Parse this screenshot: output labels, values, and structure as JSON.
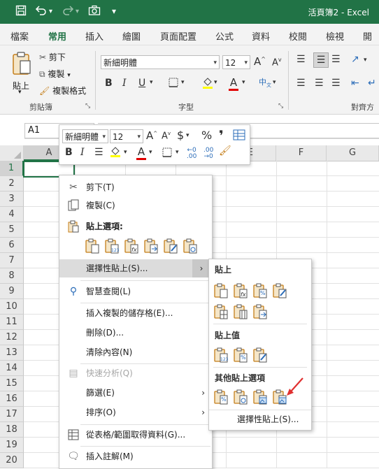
{
  "window": {
    "title": "活頁簿2 - Excel"
  },
  "qat": {
    "save_icon": "save-icon",
    "undo_icon": "undo-icon",
    "redo_icon": "redo-icon",
    "camera_icon": "camera-icon",
    "customize_icon": "customize-qat-icon"
  },
  "tabs": [
    {
      "label": "檔案"
    },
    {
      "label": "常用"
    },
    {
      "label": "插入"
    },
    {
      "label": "繪圖"
    },
    {
      "label": "頁面配置"
    },
    {
      "label": "公式"
    },
    {
      "label": "資料"
    },
    {
      "label": "校閱"
    },
    {
      "label": "檢視"
    },
    {
      "label": "開發"
    }
  ],
  "ribbon": {
    "clipboard": {
      "paste": "貼上",
      "cut": "剪下",
      "copy": "複製",
      "format_painter": "複製格式",
      "group_label": "剪貼簿"
    },
    "font": {
      "font_name": "新細明體",
      "font_size": "12",
      "group_label": "字型",
      "bold": "B",
      "italic": "I",
      "underline": "U",
      "grow": "A",
      "shrink": "A",
      "color_a": "A"
    },
    "alignment": {
      "group_label": "對齊方"
    }
  },
  "namebox": {
    "value": "A1"
  },
  "mini": {
    "font": "新細明體",
    "size": "12",
    "bold": "B",
    "italic": "I",
    "dollar": "$",
    "percent": "%",
    "comma": "❜",
    "color_a": "A",
    "grow": "A",
    "shrink": "A"
  },
  "grid": {
    "columns": [
      "A",
      "B",
      "C",
      "D",
      "E",
      "F",
      "G"
    ],
    "rows": [
      "1",
      "2",
      "3",
      "4",
      "5",
      "6",
      "7",
      "8",
      "9",
      "10",
      "11",
      "12",
      "13",
      "14",
      "15",
      "16",
      "17",
      "18",
      "19",
      "20"
    ]
  },
  "context_menu": {
    "cut": "剪下(T)",
    "copy": "複製(C)",
    "paste_options": "貼上選項:",
    "paste_special": "選擇性貼上(S)...",
    "smart_lookup": "智慧查閱(L)",
    "insert_copied": "插入複製的儲存格(E)...",
    "delete": "刪除(D)...",
    "clear": "清除內容(N)",
    "quick_analysis": "快速分析(Q)",
    "filter": "篩選(E)",
    "sort": "排序(O)",
    "get_data": "從表格/範圍取得資料(G)...",
    "insert_comment": "插入註解(M)"
  },
  "submenu": {
    "paste": "貼上",
    "paste_values": "貼上值",
    "other_paste": "其他貼上選項",
    "paste_special": "選擇性貼上(S)..."
  },
  "colors": {
    "excel_green": "#217346",
    "paste_orange": "#c47e1a",
    "blue_icon": "#2b6cb8",
    "red_arrow": "#e03030"
  }
}
